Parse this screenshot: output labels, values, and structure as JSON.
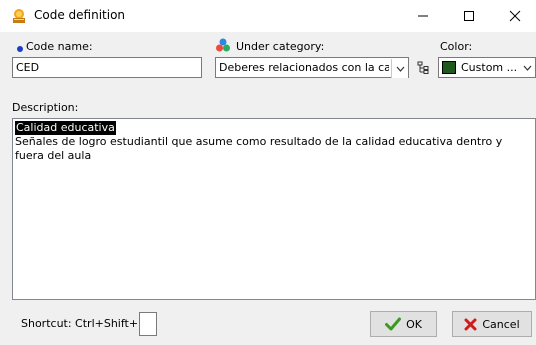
{
  "window": {
    "title": "Code definition",
    "minimize_glyph": "—",
    "maximize_glyph": "☐",
    "close_glyph": "✕"
  },
  "code_name": {
    "label": "Code name:",
    "value": "CED"
  },
  "category": {
    "label": "Under category:",
    "value": "Deberes relacionados con la ca"
  },
  "color": {
    "label": "Color:",
    "value": "Custom ...",
    "swatch": "#1e5a1e"
  },
  "description": {
    "label": "Description:",
    "title_line": "Calidad educativa",
    "body": "Señales de logro estudiantil que asume como resultado de la calidad educativa dentro y fuera del aula"
  },
  "shortcut": {
    "label": "Shortcut: Ctrl+Shift+",
    "value": ""
  },
  "buttons": {
    "ok_label": "OK",
    "cancel_label": "Cancel"
  },
  "colors": {
    "ok_check": "#3a9a1e",
    "cancel_x": "#d11a1a",
    "bullet": "#1a3ec8"
  }
}
